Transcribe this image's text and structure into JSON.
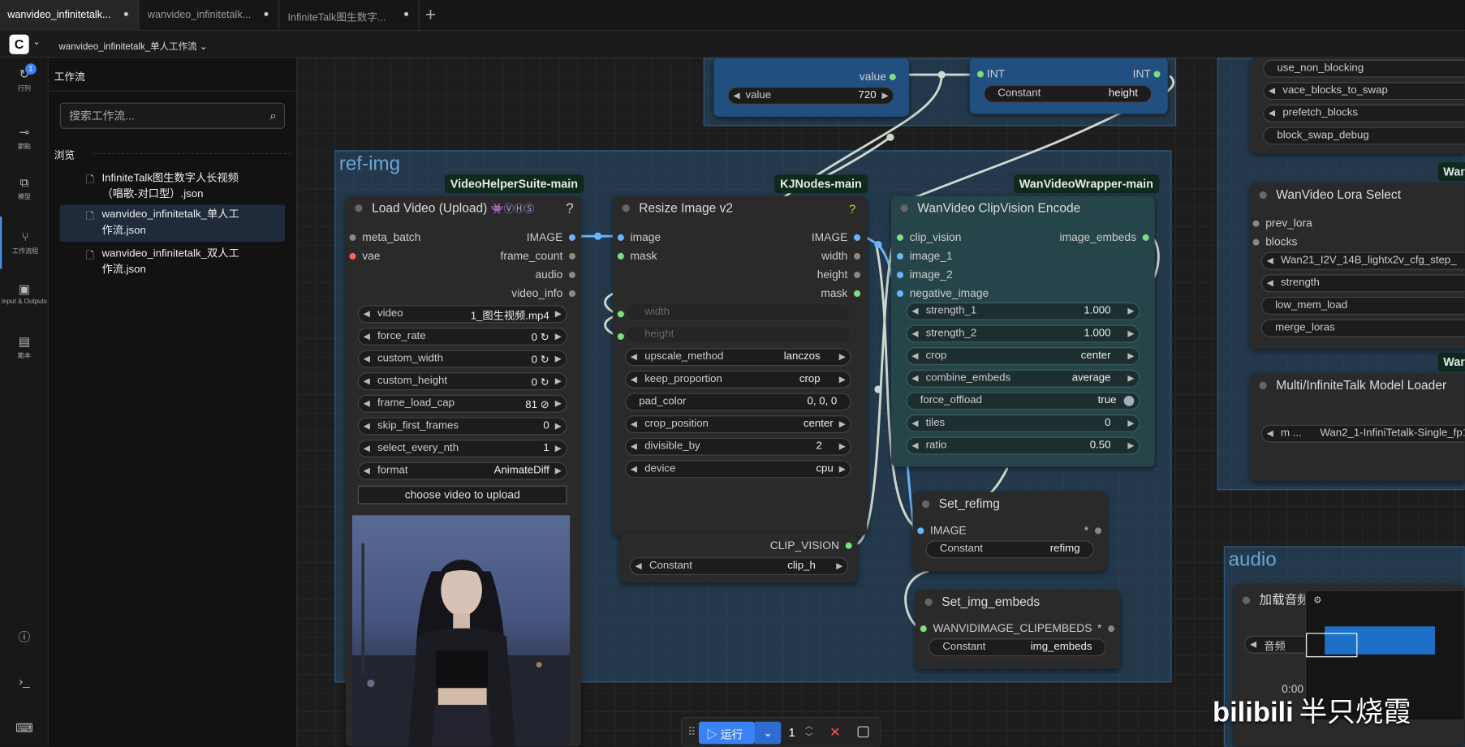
{
  "tabs": [
    {
      "label": "wanvideo_infinitetalk...",
      "active": true
    },
    {
      "label": "wanvideo_infinitetalk...",
      "active": false
    },
    {
      "label": "InfiniteTalk图生数字...",
      "active": false
    }
  ],
  "tab_modified_dot": "●",
  "workflow_title": "wanvideo_infinitetalk_单人工作流",
  "iconbar": {
    "queue": {
      "label": "行列",
      "badge": "1"
    },
    "nodes": {
      "label": "節點"
    },
    "models": {
      "label": "模型"
    },
    "workflows": {
      "label": "工作流程"
    },
    "io": {
      "label": "Input & Outputs"
    },
    "templates": {
      "label": "範本"
    }
  },
  "sidebar": {
    "title": "工作流",
    "search_placeholder": "搜索工作流...",
    "browse": "浏览",
    "files": [
      {
        "line1": "InfiniteTalk图生数字人长视频",
        "line2": "（唱歌-对口型）.json"
      },
      {
        "line1": "wanvideo_infinitetalk_单人工",
        "line2": "作流.json"
      },
      {
        "line1": "wanvideo_infinitetalk_双人工",
        "line2": "作流.json"
      }
    ]
  },
  "groups": {
    "ref_img": "ref-img",
    "audio": "audio"
  },
  "tags": {
    "vhs": "VideoHelperSuite-main",
    "kj": "KJNodes-main",
    "wan": "WanVideoWrapper-main",
    "wan_short": "Wan"
  },
  "top_nodes": {
    "value_label": "value",
    "value_widget": {
      "name": "value",
      "value": "720"
    },
    "int_in": "INT",
    "int_out": "INT",
    "constant": {
      "name": "Constant",
      "value": "height"
    }
  },
  "load_video": {
    "title": "Load Video (Upload)",
    "badges": "👾ⓋⒽⓈ",
    "help": "?",
    "inputs": [
      "meta_batch",
      "vae"
    ],
    "outputs": [
      "IMAGE",
      "frame_count",
      "audio",
      "video_info"
    ],
    "widgets": [
      {
        "name": "video",
        "value": "1_图生视频.mp4"
      },
      {
        "name": "force_rate",
        "value": "0 ↻"
      },
      {
        "name": "custom_width",
        "value": "0 ↻"
      },
      {
        "name": "custom_height",
        "value": "0 ↻"
      },
      {
        "name": "frame_load_cap",
        "value": "81 ⊘"
      },
      {
        "name": "skip_first_frames",
        "value": "0"
      },
      {
        "name": "select_every_nth",
        "value": "1"
      },
      {
        "name": "format",
        "value": "AnimateDiff"
      }
    ],
    "upload_button": "choose video to upload"
  },
  "resize": {
    "title": "Resize Image v2",
    "help": "?",
    "inputs": [
      "image",
      "mask"
    ],
    "outputs": [
      "IMAGE",
      "width",
      "height",
      "mask"
    ],
    "disabled_widgets": [
      "width",
      "height"
    ],
    "widgets": [
      {
        "name": "upscale_method",
        "value": "lanczos"
      },
      {
        "name": "keep_proportion",
        "value": "crop"
      },
      {
        "name": "pad_color",
        "value": "0, 0, 0"
      },
      {
        "name": "crop_position",
        "value": "center"
      },
      {
        "name": "divisible_by",
        "value": "2"
      },
      {
        "name": "device",
        "value": "cpu"
      }
    ]
  },
  "clip_vision_loader": {
    "output": "CLIP_VISION",
    "widget": {
      "name": "Constant",
      "value": "clip_h"
    }
  },
  "clipvision_encode": {
    "title": "WanVideo ClipVision Encode",
    "inputs": [
      "clip_vision",
      "image_1",
      "image_2",
      "negative_image"
    ],
    "output": "image_embeds",
    "widgets": [
      {
        "name": "strength_1",
        "value": "1.000"
      },
      {
        "name": "strength_2",
        "value": "1.000"
      },
      {
        "name": "crop",
        "value": "center"
      },
      {
        "name": "combine_embeds",
        "value": "average"
      },
      {
        "name": "force_offload",
        "value": "true"
      },
      {
        "name": "tiles",
        "value": "0"
      },
      {
        "name": "ratio",
        "value": "0.50"
      }
    ]
  },
  "set_refimg": {
    "title": "Set_refimg",
    "input": "IMAGE",
    "star": "*",
    "widget": {
      "name": "Constant",
      "value": "refimg"
    }
  },
  "set_img_embeds": {
    "title": "Set_img_embeds",
    "input": "WANVIDIMAGE_CLIPEMBEDS",
    "star": "*",
    "widget": {
      "name": "Constant",
      "value": "img_embeds"
    }
  },
  "right_partial": {
    "widgets": [
      "use_non_blocking",
      "vace_blocks_to_swap",
      "prefetch_blocks",
      "block_swap_debug"
    ]
  },
  "lora_select": {
    "title": "WanVideo Lora Select",
    "inputs": [
      "prev_lora",
      "blocks"
    ],
    "widgets": [
      {
        "name": "",
        "value": "Wan21_I2V_14B_lightx2v_cfg_step_"
      },
      {
        "name": "strength",
        "value": ""
      },
      {
        "name": "low_mem_load",
        "value": ""
      },
      {
        "name": "merge_loras",
        "value": ""
      }
    ]
  },
  "model_loader": {
    "title": "Multi/InfiniteTalk Model Loader",
    "widget": {
      "name": "m ...",
      "value": "Wan2_1-InfiniTetalk-Single_fp1("
    }
  },
  "audio_node": {
    "title": "加载音频",
    "widget": "音频",
    "time": "0:00"
  },
  "runbar": {
    "run_label": "运行",
    "count": "1"
  },
  "watermark": {
    "brand": "bilibili",
    "name": "半只烧霞"
  }
}
